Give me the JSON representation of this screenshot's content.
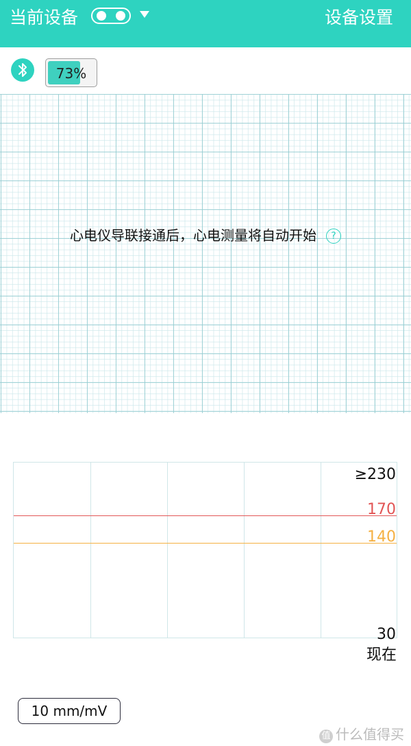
{
  "header": {
    "title": "当前设备",
    "settings_label": "设备设置",
    "toggle_state": "on",
    "caret_icon": "caret-down-icon",
    "color": "#2ed3c0"
  },
  "status": {
    "bluetooth_icon": "bluetooth-icon",
    "battery_percent": 73,
    "battery_label": "73%"
  },
  "ecg": {
    "message": "心电仪导联接通后，心电测量将自动开始",
    "help_icon": "help-icon",
    "help_glyph": "?"
  },
  "heart_rate_chart": {
    "top_label": "≥230",
    "red_label": "170",
    "orange_label": "140",
    "bottom_label": "30",
    "now_label": "现在",
    "red_color": "#e25555",
    "orange_color": "#f5b042"
  },
  "scale": {
    "label": "10 mm/mV"
  },
  "watermark": {
    "text": "什么值得买",
    "icon_glyph": "值"
  }
}
